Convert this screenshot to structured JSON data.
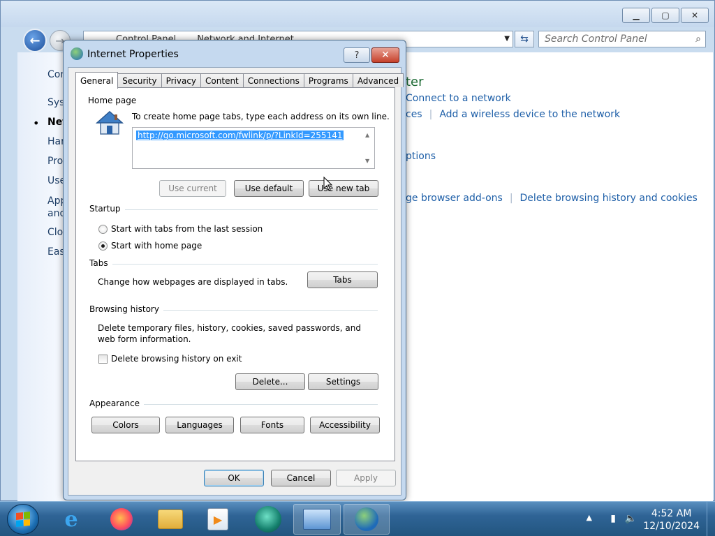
{
  "control_panel": {
    "breadcrumb": [
      "Control Panel",
      "Network and Internet"
    ],
    "search_placeholder": "Search Control Panel",
    "left_items": [
      "Control Panel Home",
      "System and Security",
      "Network and Internet",
      "Hardware and Sound",
      "Programs",
      "User Accounts",
      "Appearance and Personalization",
      "Clock, Language, and Region",
      "Ease of Access"
    ],
    "heading_fragment": "ter",
    "links": {
      "connect": "Connect to a network",
      "services_fragment": "ces",
      "wireless": "Add a wireless device to the network",
      "options_fragment": "ptions",
      "addons_fragment": "ge browser add-ons",
      "delete_history": "Delete browsing history and cookies"
    }
  },
  "dialog": {
    "title": "Internet Properties",
    "help_glyph": "?",
    "close_glyph": "✕",
    "tabs": [
      {
        "label": "General",
        "active": true
      },
      {
        "label": "Security",
        "active": false
      },
      {
        "label": "Privacy",
        "active": false
      },
      {
        "label": "Content",
        "active": false
      },
      {
        "label": "Connections",
        "active": false
      },
      {
        "label": "Programs",
        "active": false
      },
      {
        "label": "Advanced",
        "active": false
      }
    ],
    "home_page": {
      "group_label": "Home page",
      "instruction": "To create home page tabs, type each address on its own line.",
      "url": "http://go.microsoft.com/fwlink/p/?LinkId=255141",
      "use_current": "Use current",
      "use_default": "Use default",
      "use_new_tab": "Use new tab"
    },
    "startup": {
      "group_label": "Startup",
      "option_last_session": "Start with tabs from the last session",
      "option_home_page": "Start with home page",
      "selected": "home_page"
    },
    "tabs_group": {
      "group_label": "Tabs",
      "description": "Change how webpages are displayed in tabs.",
      "button": "Tabs"
    },
    "browsing_history": {
      "group_label": "Browsing history",
      "description_line1": "Delete temporary files, history, cookies, saved passwords, and",
      "description_line2": "web form information.",
      "delete_on_exit": "Delete browsing history on exit",
      "delete_on_exit_checked": false,
      "delete_button": "Delete...",
      "settings_button": "Settings"
    },
    "appearance": {
      "group_label": "Appearance",
      "colors": "Colors",
      "languages": "Languages",
      "fonts": "Fonts",
      "accessibility": "Accessibility"
    },
    "footer": {
      "ok": "OK",
      "cancel": "Cancel",
      "apply": "Apply"
    }
  },
  "taskbar": {
    "time": "4:52 AM",
    "date": "12/10/2024",
    "apps": [
      "internet-explorer",
      "firefox",
      "file-explorer",
      "media-player",
      "chat-app",
      "control-panel",
      "internet-properties"
    ]
  }
}
